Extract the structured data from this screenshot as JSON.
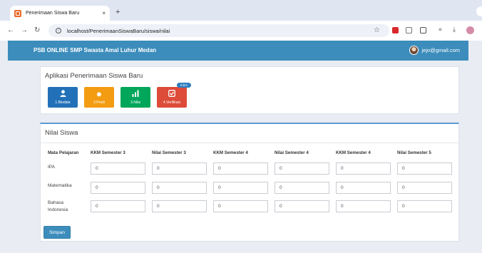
{
  "browser": {
    "tab_title": "Penerimaan Siswa Baru",
    "tab_close": "×",
    "new_tab": "+",
    "url": "localhost/PenerimaanSiswaBaru/siswa/nilai"
  },
  "header": {
    "brand": "PSB ONLINE SMP Swasta Amal Luhur Medan",
    "user_email": "jejo@gmail.com"
  },
  "app_panel": {
    "title": "Aplikasi Penerimaan Siswa Baru",
    "tiles": [
      {
        "label": "1.Biodata",
        "icon": "user-icon",
        "color": "#2271b8"
      },
      {
        "label": "2.Prodi",
        "icon": "sun-icon",
        "color": "#f39c12"
      },
      {
        "label": "3.Nilai",
        "icon": "bar-chart-icon",
        "color": "#00a65a"
      },
      {
        "label": "4.Verifikasi",
        "icon": "check-square-icon",
        "color": "#dd4b39",
        "badge": "Kirim"
      }
    ]
  },
  "grades": {
    "title": "Nilai Siswa",
    "columns": [
      "Mata Pelajaran",
      "KKM Semester 3",
      "Nilai Semester 3",
      "KKM Semester 4",
      "Nilai Semester 4",
      "KKM Semester 4",
      "Nilai Semester 5"
    ],
    "rows": [
      {
        "subject": "IPA",
        "values": [
          "0",
          "0",
          "0",
          "0",
          "0",
          "0"
        ]
      },
      {
        "subject": "Matematika",
        "values": [
          "0",
          "0",
          "0",
          "0",
          "0",
          "0"
        ]
      },
      {
        "subject": "Bahasa Indonesia",
        "values": [
          "0",
          "0",
          "0",
          "0",
          "0",
          "0"
        ]
      }
    ],
    "save_label": "Simpan"
  }
}
